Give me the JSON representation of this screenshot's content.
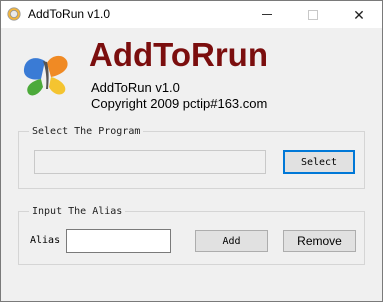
{
  "window": {
    "title": "AddToRun v1.0",
    "controls": {
      "minimize_icon": "minimize-icon",
      "maximize_icon": "maximize-icon",
      "close_glyph": "✕"
    }
  },
  "header": {
    "app_name": "AddToRrun",
    "version": "AddToRun v1.0",
    "copyright": "Copyright 2009 pctip#163.com",
    "name_color": "#7b0e0e"
  },
  "program_group": {
    "legend": "Select The Program",
    "path_value": "",
    "select_label": "Select"
  },
  "alias_group": {
    "legend": "Input The Alias",
    "alias_label": "Alias",
    "alias_value": "",
    "add_label": "Add",
    "remove_label": "Remove"
  },
  "colors": {
    "accent": "#0078d7",
    "background": "#f0f0f0",
    "button_face": "#e1e1e1"
  }
}
